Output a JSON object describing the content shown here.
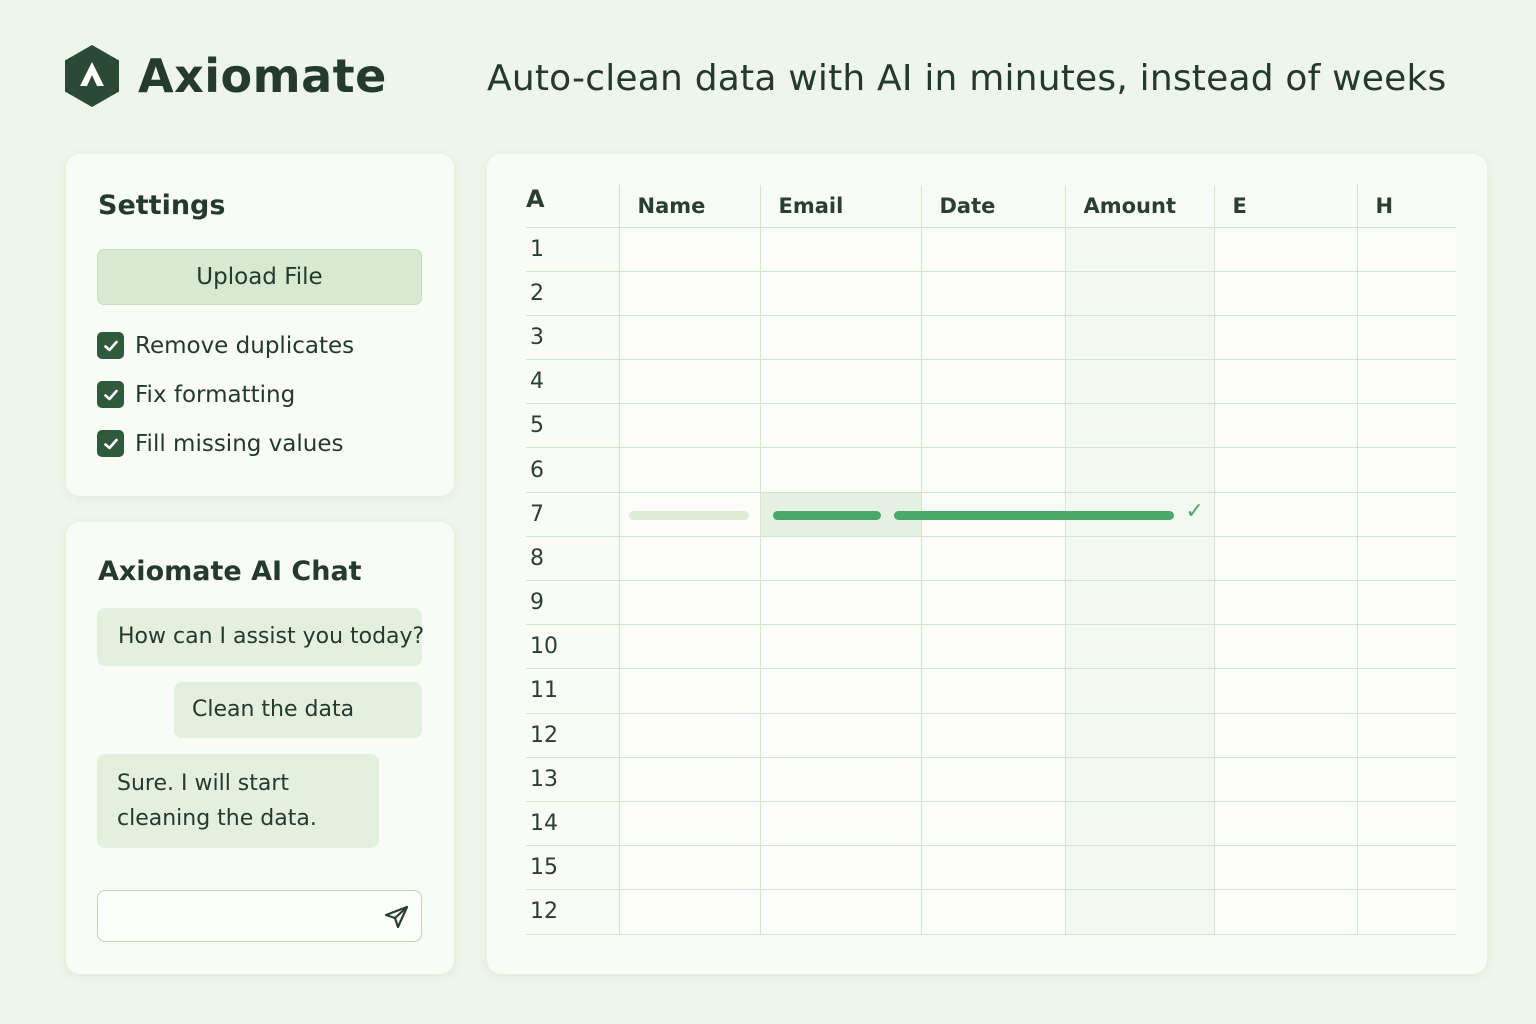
{
  "brand": {
    "name": "Axiomate",
    "logo_icon": "hexagon-a-logo-icon"
  },
  "tagline": "Auto-clean data with AI in minutes, instead of weeks",
  "settings": {
    "title": "Settings",
    "upload_label": "Upload File",
    "options": [
      {
        "label": "Remove duplicates",
        "checked": true
      },
      {
        "label": "Fix formatting",
        "checked": true
      },
      {
        "label": "Fill missing values",
        "checked": true
      }
    ]
  },
  "chat": {
    "title": "Axiomate AI Chat",
    "messages": [
      {
        "from": "ai",
        "text": "How can I assist you today?"
      },
      {
        "from": "user",
        "text": "Clean the data"
      },
      {
        "from": "ai",
        "text": "Sure. I will start cleaning the data."
      }
    ],
    "input_value": "",
    "send_icon": "send-icon"
  },
  "sheet": {
    "corner": "A",
    "columns": [
      "Name",
      "Email",
      "Date",
      "Amount",
      "E",
      "H"
    ],
    "rows": [
      "1",
      "2",
      "3",
      "4",
      "5",
      "6",
      "7",
      "8",
      "9",
      "10",
      "11",
      "12",
      "13",
      "14",
      "15",
      "12"
    ],
    "processing_row": "7",
    "processing_status_icon": "checkmark-icon"
  },
  "colors": {
    "accent": "#4aa86a",
    "brand_dark": "#2d5b3c",
    "background": "#eef5ea",
    "button": "#d7ead1"
  }
}
